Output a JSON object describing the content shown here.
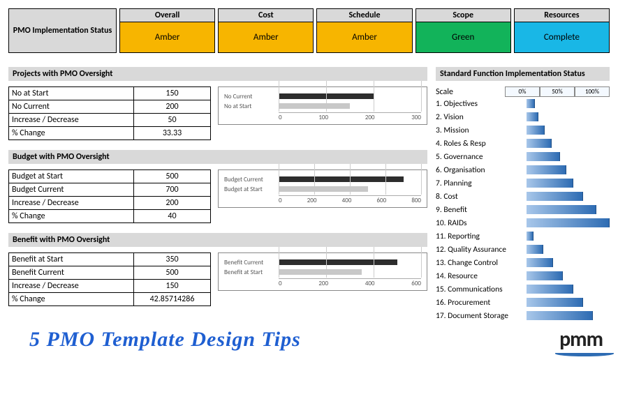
{
  "status": {
    "label": "PMO Implementation Status",
    "cols": [
      {
        "head": "Overall",
        "val": "Amber",
        "color": "#f7b500"
      },
      {
        "head": "Cost",
        "val": "Amber",
        "color": "#f7b500"
      },
      {
        "head": "Schedule",
        "val": "Amber",
        "color": "#f7b500"
      },
      {
        "head": "Scope",
        "val": "Green",
        "color": "#12b35a"
      },
      {
        "head": "Resources",
        "val": "Complete",
        "color": "#19b7e6"
      }
    ]
  },
  "left_sections": [
    {
      "title": "Projects with PMO Oversight",
      "rows": [
        {
          "k": "No at Start",
          "v": "150"
        },
        {
          "k": "No Current",
          "v": "200"
        },
        {
          "k": "Increase / Decrease",
          "v": "50"
        },
        {
          "k": "% Change",
          "v": "33.33"
        }
      ],
      "chart": {
        "series": [
          {
            "name": "No Current",
            "value": 200,
            "shade": "dark"
          },
          {
            "name": "No at Start",
            "value": 150,
            "shade": "light"
          }
        ],
        "ticks": [
          "0",
          "100",
          "200",
          "300"
        ],
        "max": 300
      }
    },
    {
      "title": "Budget with PMO Oversight",
      "rows": [
        {
          "k": "Budget at Start",
          "v": "500"
        },
        {
          "k": "Budget Current",
          "v": "700"
        },
        {
          "k": "Increase / Decrease",
          "v": "200"
        },
        {
          "k": "% Change",
          "v": "40"
        }
      ],
      "chart": {
        "series": [
          {
            "name": "Budget Current",
            "value": 700,
            "shade": "dark"
          },
          {
            "name": "Budget at Start",
            "value": 500,
            "shade": "light"
          }
        ],
        "ticks": [
          "0",
          "200",
          "400",
          "600",
          "800"
        ],
        "max": 800
      }
    },
    {
      "title": "Benefit with PMO Oversight",
      "rows": [
        {
          "k": "Benefit at Start",
          "v": "350"
        },
        {
          "k": "Benefit Current",
          "v": "500"
        },
        {
          "k": "Increase / Decrease",
          "v": "150"
        },
        {
          "k": "% Change",
          "v": "42.85714286"
        }
      ],
      "chart": {
        "series": [
          {
            "name": "Benefit Current",
            "value": 500,
            "shade": "dark"
          },
          {
            "name": "Benefit at Start",
            "value": 350,
            "shade": "light"
          }
        ],
        "ticks": [
          "0",
          "200",
          "400",
          "600"
        ],
        "max": 600
      }
    }
  ],
  "right": {
    "title": "Standard Function Implementation Status",
    "scale_label": "Scale",
    "scale_ticks": [
      "0%",
      "50%",
      "100%"
    ],
    "items": [
      {
        "label": "1. Objectives",
        "pct": 10
      },
      {
        "label": "2. Vision",
        "pct": 14
      },
      {
        "label": "3. Mission",
        "pct": 22
      },
      {
        "label": "4. Roles & Resp",
        "pct": 30
      },
      {
        "label": "5. Governance",
        "pct": 40
      },
      {
        "label": "6. Organisation",
        "pct": 48
      },
      {
        "label": "7. Planning",
        "pct": 56
      },
      {
        "label": "8. Cost",
        "pct": 68
      },
      {
        "label": "9. Benefit",
        "pct": 84
      },
      {
        "label": "10. RAIDs",
        "pct": 100
      },
      {
        "label": "11. Reporting",
        "pct": 8
      },
      {
        "label": "12. Quality Assurance",
        "pct": 20
      },
      {
        "label": "13. Change Control",
        "pct": 32
      },
      {
        "label": "14. Resource",
        "pct": 44
      },
      {
        "label": "15. Communications",
        "pct": 56
      },
      {
        "label": "16. Procurement",
        "pct": 68
      },
      {
        "label": "17. Document Storage",
        "pct": 80
      }
    ]
  },
  "footer": {
    "tip": "5 PMO Template Design Tips",
    "logo": "pmm"
  },
  "chart_data": [
    {
      "type": "bar",
      "orientation": "horizontal",
      "title": "Projects with PMO Oversight",
      "categories": [
        "No Current",
        "No at Start"
      ],
      "values": [
        200,
        150
      ],
      "xlim": [
        0,
        300
      ],
      "xticks": [
        0,
        100,
        200,
        300
      ]
    },
    {
      "type": "bar",
      "orientation": "horizontal",
      "title": "Budget with PMO Oversight",
      "categories": [
        "Budget Current",
        "Budget at Start"
      ],
      "values": [
        700,
        500
      ],
      "xlim": [
        0,
        800
      ],
      "xticks": [
        0,
        200,
        400,
        600,
        800
      ]
    },
    {
      "type": "bar",
      "orientation": "horizontal",
      "title": "Benefit with PMO Oversight",
      "categories": [
        "Benefit Current",
        "Benefit at Start"
      ],
      "values": [
        500,
        350
      ],
      "xlim": [
        0,
        600
      ],
      "xticks": [
        0,
        200,
        400,
        600
      ]
    },
    {
      "type": "bar",
      "orientation": "horizontal",
      "title": "Standard Function Implementation Status",
      "xlabel": "Scale",
      "xlim": [
        0,
        100
      ],
      "xticks": [
        0,
        50,
        100
      ],
      "categories": [
        "1. Objectives",
        "2. Vision",
        "3. Mission",
        "4. Roles & Resp",
        "5. Governance",
        "6. Organisation",
        "7. Planning",
        "8. Cost",
        "9. Benefit",
        "10. RAIDs",
        "11. Reporting",
        "12. Quality Assurance",
        "13. Change Control",
        "14. Resource",
        "15. Communications",
        "16. Procurement",
        "17. Document Storage"
      ],
      "values": [
        10,
        14,
        22,
        30,
        40,
        48,
        56,
        68,
        84,
        100,
        8,
        20,
        32,
        44,
        56,
        68,
        80
      ]
    }
  ]
}
